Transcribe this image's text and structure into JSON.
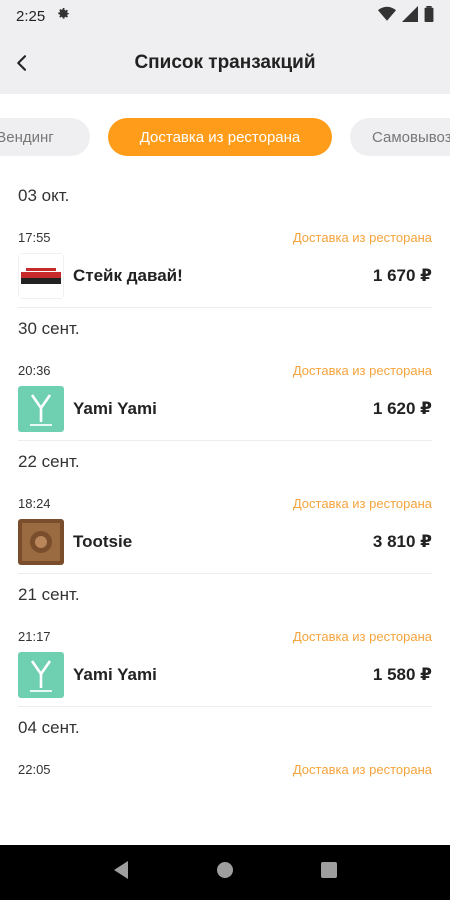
{
  "status_bar": {
    "time": "2:25"
  },
  "app_bar": {
    "title": "Список транзакций"
  },
  "tabs": [
    {
      "label": "Вендинг"
    },
    {
      "label": "Доставка из ресторана"
    },
    {
      "label": "Самовывоз"
    }
  ],
  "groups": [
    {
      "date": "03 окт.",
      "time": "17:55",
      "type": "Доставка из ресторана",
      "merchant": "Стейк давай!",
      "amount": "1 670 ₽",
      "logo": "steak-logo"
    },
    {
      "date": "30 сент.",
      "time": "20:36",
      "type": "Доставка из ресторана",
      "merchant": "Yami Yami",
      "amount": "1 620 ₽",
      "logo": "yami-logo"
    },
    {
      "date": "22 сент.",
      "time": "18:24",
      "type": "Доставка из ресторана",
      "merchant": "Tootsie",
      "amount": "3 810 ₽",
      "logo": "tootsie-logo"
    },
    {
      "date": "21 сент.",
      "time": "21:17",
      "type": "Доставка из ресторана",
      "merchant": "Yami Yami",
      "amount": "1 580 ₽",
      "logo": "yami-logo"
    },
    {
      "date": "04 сент.",
      "time": "22:05",
      "type": "Доставка из ресторана"
    }
  ],
  "colors": {
    "accent": "#ff9d1b",
    "type_text": "#f5a33c",
    "bar_bg": "#efeff1"
  }
}
